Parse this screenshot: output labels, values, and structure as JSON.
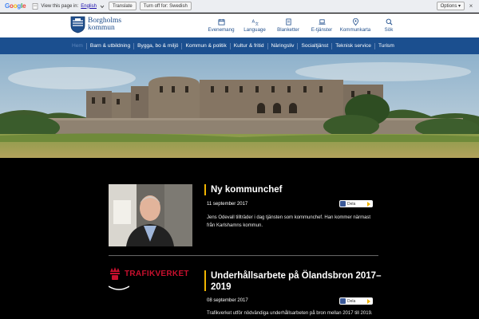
{
  "translate_bar": {
    "logo_letters": [
      "G",
      "o",
      "o",
      "g",
      "l",
      "e"
    ],
    "logo_colors": [
      "#4285f4",
      "#ea4335",
      "#fbbc05",
      "#4285f4",
      "#34a853",
      "#ea4335"
    ],
    "prompt": "View this page in:",
    "language": "English",
    "translate_button": "Translate",
    "turn_off_button": "Turn off for: Swedish",
    "options_button": "Options ▾",
    "close": "×"
  },
  "header": {
    "logo_line1": "Borgholms",
    "logo_line2": "kommun",
    "tools": [
      {
        "label": "Evenemang",
        "icon": "calendar-icon"
      },
      {
        "label": "Language",
        "icon": "translate-icon"
      },
      {
        "label": "Blanketter",
        "icon": "form-icon"
      },
      {
        "label": "E-tjänster",
        "icon": "laptop-icon"
      },
      {
        "label": "Kommunkarta",
        "icon": "map-pin-icon"
      },
      {
        "label": "Sök",
        "icon": "search-icon"
      }
    ]
  },
  "nav": {
    "items": [
      "Hem",
      "Barn & utbildning",
      "Bygga, bo & miljö",
      "Kommun & politik",
      "Kultur & fritid",
      "Näringsliv",
      "Socialtjänst",
      "Teknisk service",
      "Turism"
    ]
  },
  "news": [
    {
      "title": "Ny kommunchef",
      "date": "11 september 2017",
      "text": "Jens Odevall tillträder i dag tjänsten som kommunchef. Han kommer närmast från Karlshamns kommun.",
      "share_label": "Dela"
    },
    {
      "title": "Underhållsarbete på Ölandsbron 2017–2019",
      "date": "08 september 2017",
      "text": "Trafikverket utför nödvändiga underhållsarbeten på bron mellan 2017 till 2019.",
      "share_label": "Dela",
      "logo_text": "TRAFIKVERKET"
    }
  ],
  "colors": {
    "brand_blue": "#1b4f8f",
    "accent_yellow": "#f0b400",
    "trafikverket_red": "#c8102e"
  }
}
